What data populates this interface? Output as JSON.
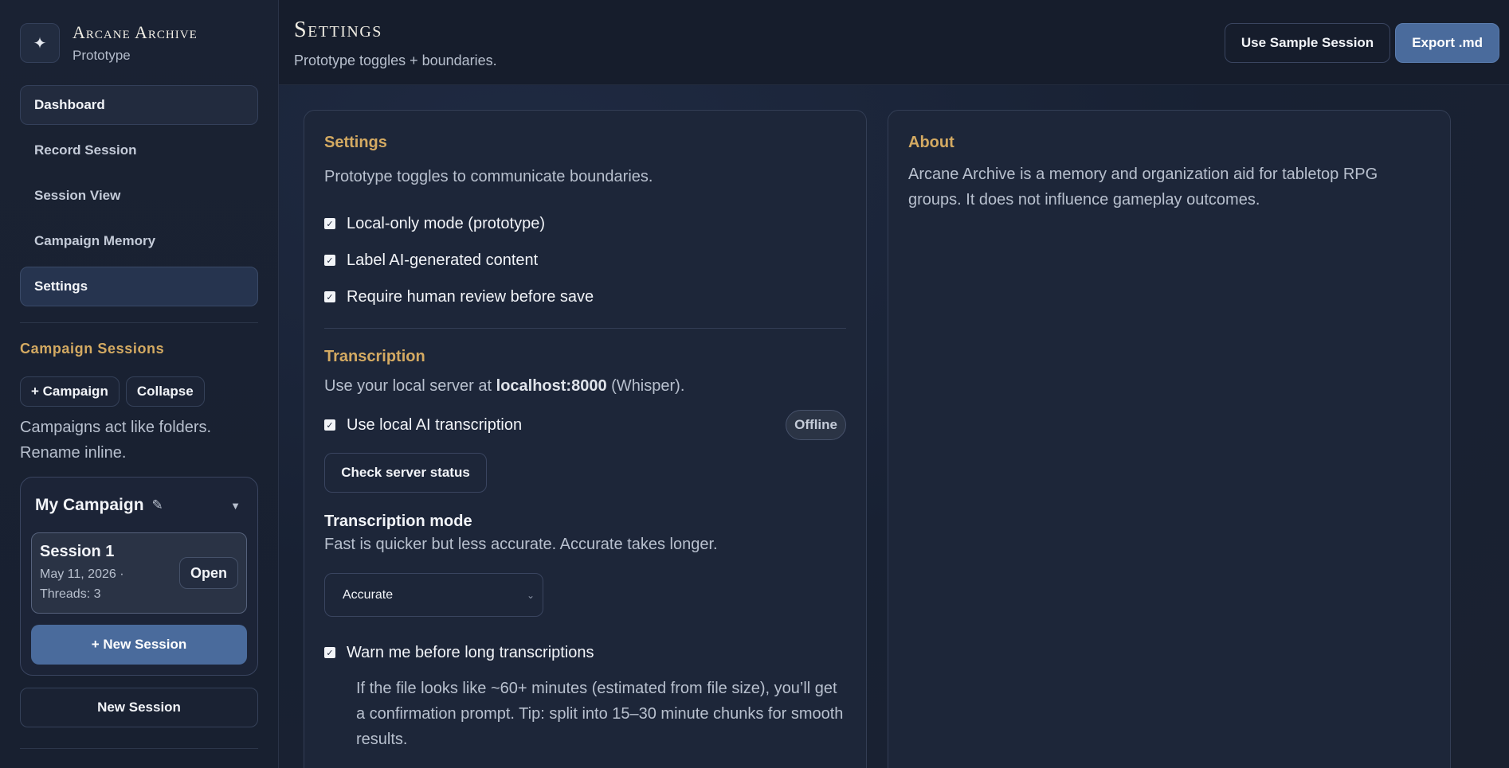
{
  "brand": {
    "title": "Arcane Archive",
    "subtitle": "Prototype",
    "logo_icon": "✦"
  },
  "nav": {
    "items": [
      {
        "label": "Dashboard"
      },
      {
        "label": "Record Session"
      },
      {
        "label": "Session View"
      },
      {
        "label": "Campaign Memory"
      },
      {
        "label": "Settings"
      }
    ]
  },
  "campaign_sessions": {
    "title": "Campaign Sessions",
    "add_campaign_label": "+ Campaign",
    "collapse_label": "Collapse",
    "note": "Campaigns act like folders. Rename inline.",
    "campaign": {
      "name": "My Campaign",
      "session": {
        "title": "Session 1",
        "meta": "May 11, 2026 · Threads: 3",
        "open_label": "Open"
      },
      "new_session_label": "+ New Session"
    },
    "new_session_label": "New Session"
  },
  "header": {
    "title": "Settings",
    "subtitle": "Prototype toggles + boundaries.",
    "use_sample_label": "Use Sample Session",
    "export_label": "Export .md"
  },
  "settings_panel": {
    "title": "Settings",
    "subtitle": "Prototype toggles to communicate boundaries.",
    "toggles": [
      {
        "label": "Local-only mode (prototype)",
        "checked": true
      },
      {
        "label": "Label AI-generated content",
        "checked": true
      },
      {
        "label": "Require human review before save",
        "checked": true
      }
    ],
    "transcription": {
      "title": "Transcription",
      "server_prefix": "Use your local server at ",
      "server_host": "localhost:8000",
      "server_suffix": " (Whisper).",
      "local_ai_label": "Use local AI transcription",
      "status_badge": "Offline",
      "check_server_label": "Check server status",
      "mode_title": "Transcription mode",
      "mode_desc": "Fast is quicker but less accurate. Accurate takes longer.",
      "mode_selected": "Accurate",
      "warn_label": "Warn me before long transcriptions",
      "warn_note": "If the file looks like ~60+ minutes (estimated from file size), you’ll get a confirmation prompt. Tip: split into 15–30 minute chunks for smooth results."
    }
  },
  "about_panel": {
    "title": "About",
    "text": "Arcane Archive is a memory and organization aid for tabletop RPG groups. It does not influence gameplay outcomes."
  },
  "colors": {
    "accent_gold": "#d4aa62",
    "primary_blue": "#4a6b9c",
    "background": "#151c2b"
  }
}
